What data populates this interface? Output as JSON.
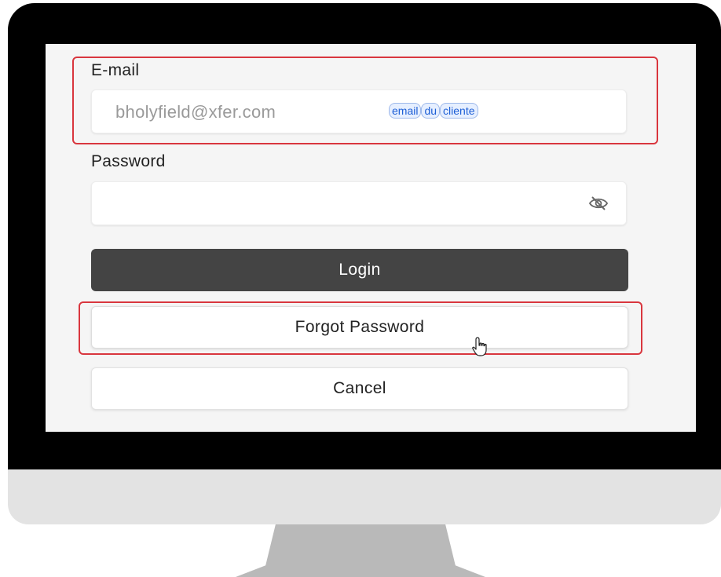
{
  "email_field": {
    "label": "E-mail",
    "value": "bholyfield@xfer.com",
    "annotation_chips": [
      "email",
      "du",
      "cliente"
    ]
  },
  "password_field": {
    "label": "Password",
    "value": "",
    "toggle_icon": "eye-slash-icon"
  },
  "buttons": {
    "login": "Login",
    "forgot_password": "Forgot Password",
    "cancel": "Cancel"
  },
  "colors": {
    "highlight": "#d9363e",
    "login_bg": "#444444",
    "chip_text": "#1d5fd6"
  },
  "icons": {
    "cursor": "hand-pointer-icon"
  }
}
